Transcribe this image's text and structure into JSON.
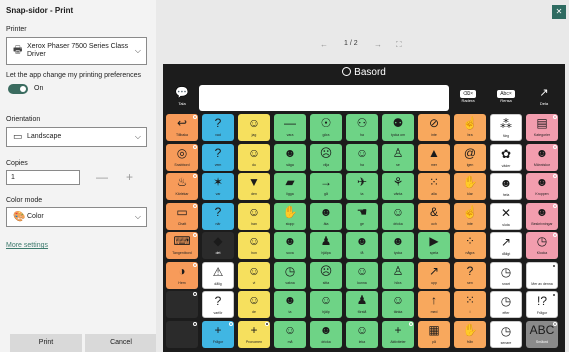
{
  "dialog": {
    "title": "Snap-sidor - Print",
    "close_glyph": "✕",
    "printer_label": "Printer",
    "printer_value": "Xerox Phaser 7500 Series Class Driver",
    "pref_label": "Let the app change my printing preferences",
    "pref_state": "On",
    "orientation_label": "Orientation",
    "orientation_value": "Landscape",
    "copies_label": "Copies",
    "copies_value": "1",
    "minus": "—",
    "plus": "+",
    "color_label": "Color mode",
    "color_value": "Color",
    "more_settings": "More settings",
    "print_button": "Print",
    "cancel_button": "Cancel"
  },
  "preview": {
    "page_indicator": "1 / 2",
    "prev_glyph": "←",
    "next_glyph": "→",
    "fit_glyph": "⛶",
    "page_title": "Basord",
    "top_buttons": [
      {
        "glyph": "💬",
        "label": "Tala"
      },
      {
        "glyph": "⌫×",
        "label": "Radera"
      },
      {
        "glyph": "Abc×",
        "label": "Rensa"
      },
      {
        "glyph": "↗",
        "label": "Dela"
      }
    ]
  },
  "colors": {
    "orange": "#f79b5a",
    "blue": "#40b6e3",
    "yellow": "#f6e05e",
    "green": "#6ed386",
    "light_orange": "#f8a85d",
    "white": "#ffffff",
    "pink": "#f29dae",
    "dark": "#2b2b2b",
    "gray": "#8a8a8a",
    "accent": "#3a6b5f"
  },
  "grid": [
    [
      {
        "c": "orange",
        "s": "↩",
        "t": "Tillbaka"
      },
      {
        "c": "blue",
        "s": "?",
        "t": "vad"
      },
      {
        "c": "yellow",
        "s": "☺",
        "t": "jag"
      },
      {
        "c": "green",
        "s": "—",
        "t": "vara"
      },
      {
        "c": "green",
        "s": "☉",
        "t": "göra"
      },
      {
        "c": "green",
        "s": "⚇",
        "t": "ha"
      },
      {
        "c": "green",
        "s": "⚉",
        "t": "tycka om"
      },
      {
        "c": "light_orange",
        "s": "⊘",
        "t": "inte"
      },
      {
        "c": "light_orange",
        "s": "☝",
        "t": "bra"
      },
      {
        "c": "white",
        "s": "⁂",
        "t": "färg"
      },
      {
        "c": "pink",
        "s": "▤",
        "t": "Kategorier"
      }
    ],
    [
      {
        "c": "orange",
        "s": "◎",
        "t": "Snabbord"
      },
      {
        "c": "blue",
        "s": "?",
        "t": "vem"
      },
      {
        "c": "yellow",
        "s": "☺",
        "t": "du"
      },
      {
        "c": "green",
        "s": "☻",
        "t": "säga"
      },
      {
        "c": "green",
        "s": "☹",
        "t": "vilja"
      },
      {
        "c": "green",
        "s": "☺",
        "t": "ha"
      },
      {
        "c": "green",
        "s": "♙",
        "t": "se"
      },
      {
        "c": "light_orange",
        "s": "▲",
        "t": "mer"
      },
      {
        "c": "light_orange",
        "s": "@",
        "t": "igen"
      },
      {
        "c": "white",
        "s": "✿",
        "t": "väder"
      },
      {
        "c": "pink",
        "s": "☻",
        "t": "Människor"
      }
    ],
    [
      {
        "c": "orange",
        "s": "♨",
        "t": "Kärlekar"
      },
      {
        "c": "blue",
        "s": "✶",
        "t": "var"
      },
      {
        "c": "yellow",
        "s": "▼",
        "t": "den"
      },
      {
        "c": "green",
        "s": "▰",
        "t": "ligga"
      },
      {
        "c": "green",
        "s": "→",
        "t": "gå"
      },
      {
        "c": "green",
        "s": "✈",
        "t": "ta"
      },
      {
        "c": "green",
        "s": "⚘",
        "t": "vänta"
      },
      {
        "c": "light_orange",
        "s": "⁙",
        "t": "alla"
      },
      {
        "c": "light_orange",
        "s": "✋",
        "t": "klar"
      },
      {
        "c": "white",
        "s": "☻",
        "t": "hela"
      },
      {
        "c": "pink",
        "s": "☻",
        "t": "Kroppen"
      }
    ],
    [
      {
        "c": "orange",
        "s": "▭",
        "t": "Chatt"
      },
      {
        "c": "blue",
        "s": "?",
        "t": "när"
      },
      {
        "c": "yellow",
        "s": "☺",
        "t": "han"
      },
      {
        "c": "green",
        "s": "✋",
        "t": "stopp"
      },
      {
        "c": "green",
        "s": "☻",
        "t": "äta"
      },
      {
        "c": "green",
        "s": "☚",
        "t": "ge"
      },
      {
        "c": "green",
        "s": "☺",
        "t": "dricka"
      },
      {
        "c": "light_orange",
        "s": "&",
        "t": "och"
      },
      {
        "c": "light_orange",
        "s": "☝",
        "t": "inte"
      },
      {
        "c": "white",
        "s": "✕",
        "t": "sluta"
      },
      {
        "c": "pink",
        "s": "☻",
        "t": "Beskrivningar"
      }
    ],
    [
      {
        "c": "orange",
        "s": "⌨",
        "t": "Tangentbord"
      },
      {
        "c": "dark",
        "s": "◆",
        "t": "det"
      },
      {
        "c": "yellow",
        "s": "☺",
        "t": "hon"
      },
      {
        "c": "green",
        "s": "☻",
        "t": "sova"
      },
      {
        "c": "green",
        "s": "♟",
        "t": "hjälpa"
      },
      {
        "c": "green",
        "s": "☻",
        "t": "få"
      },
      {
        "c": "green",
        "s": "☻",
        "t": "tycka"
      },
      {
        "c": "green",
        "s": "▶",
        "t": "spela"
      },
      {
        "c": "light_orange",
        "s": "⁘",
        "t": "några"
      },
      {
        "c": "white",
        "s": "↗",
        "t": "dåligt"
      },
      {
        "c": "pink",
        "s": "◷",
        "t": "Klocka"
      }
    ],
    [
      {
        "c": "orange",
        "s": "◑",
        "t": "Hem"
      },
      {
        "c": "white",
        "s": "⚠",
        "t": "dålig"
      },
      {
        "c": "yellow",
        "s": "☺",
        "t": "vi"
      },
      {
        "c": "green",
        "s": "◷",
        "t": "vakna"
      },
      {
        "c": "green",
        "s": "☹",
        "t": "sitta"
      },
      {
        "c": "green",
        "s": "☺",
        "t": "kunna"
      },
      {
        "c": "green",
        "s": "♙",
        "t": "höra"
      },
      {
        "c": "light_orange",
        "s": "↗",
        "t": "upp"
      },
      {
        "c": "light_orange",
        "s": "?",
        "t": "sen"
      },
      {
        "c": "white",
        "s": "◷",
        "t": "snart"
      },
      {
        "c": "white",
        "s": "",
        "t": "Mer av denna"
      }
    ],
    [
      {
        "c": "dark",
        "s": "",
        "t": ""
      },
      {
        "c": "white",
        "s": "?",
        "t": "varför"
      },
      {
        "c": "yellow",
        "s": "☺",
        "t": "de"
      },
      {
        "c": "green",
        "s": "☻",
        "t": "ta"
      },
      {
        "c": "green",
        "s": "☺",
        "t": "hjälp"
      },
      {
        "c": "green",
        "s": "♟",
        "t": "förstå"
      },
      {
        "c": "green",
        "s": "☺",
        "t": "tänka"
      },
      {
        "c": "light_orange",
        "s": "↑",
        "t": "med"
      },
      {
        "c": "light_orange",
        "s": "⁙",
        "t": "i"
      },
      {
        "c": "white",
        "s": "◷",
        "t": "efter"
      },
      {
        "c": "white",
        "s": "!?",
        "t": "Frågor"
      }
    ],
    [
      {
        "c": "dark",
        "s": "",
        "t": ""
      },
      {
        "c": "blue",
        "s": "+",
        "t": "Frågor"
      },
      {
        "c": "yellow",
        "s": "+",
        "t": "Pronomen"
      },
      {
        "c": "green",
        "s": "☺",
        "t": "må"
      },
      {
        "c": "green",
        "s": "☻",
        "t": "dricka"
      },
      {
        "c": "green",
        "s": "☺",
        "t": "leka"
      },
      {
        "c": "green",
        "s": "+",
        "t": "Aktiviteter"
      },
      {
        "c": "light_orange",
        "s": "▦",
        "t": "på"
      },
      {
        "c": "light_orange",
        "s": "✋",
        "t": "från"
      },
      {
        "c": "white",
        "s": "◷",
        "t": "senare"
      },
      {
        "c": "gray",
        "s": "ABC",
        "t": "Småord"
      }
    ]
  ]
}
